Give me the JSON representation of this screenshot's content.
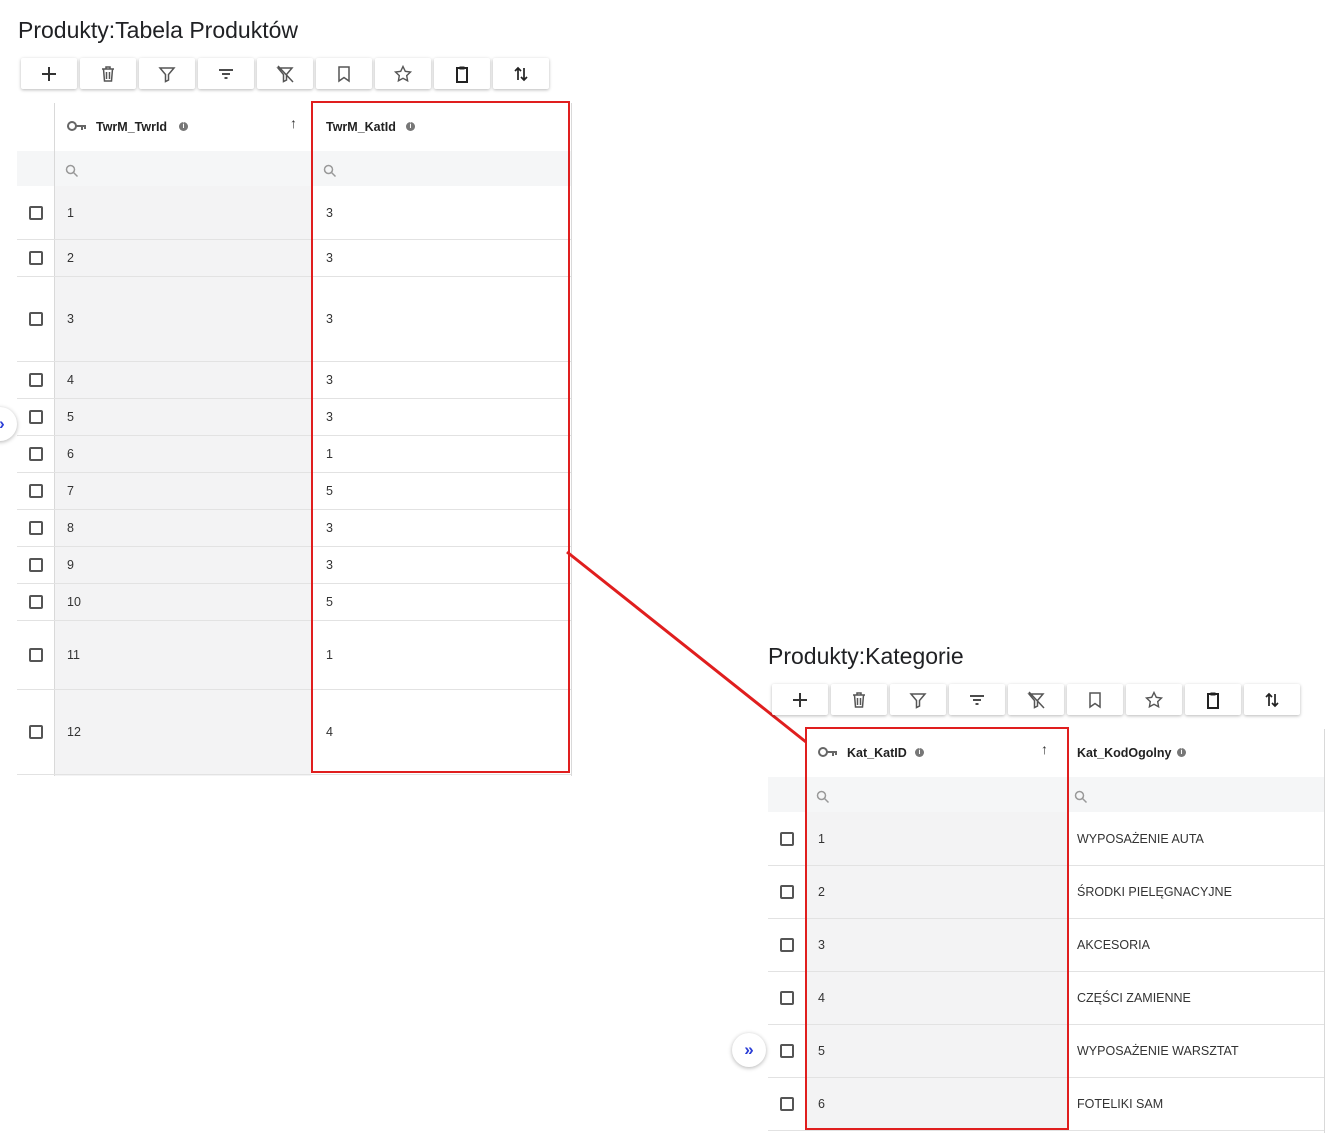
{
  "panel1": {
    "title": "Produkty:Tabela Produktów",
    "col1_header": "TwrM_TwrId",
    "col2_header": "TwrM_KatId",
    "sort_arrow": "↑",
    "rows": [
      {
        "id": "1",
        "kat": "3"
      },
      {
        "id": "2",
        "kat": "3"
      },
      {
        "id": "3",
        "kat": "3"
      },
      {
        "id": "4",
        "kat": "3"
      },
      {
        "id": "5",
        "kat": "3"
      },
      {
        "id": "6",
        "kat": "1"
      },
      {
        "id": "7",
        "kat": "5"
      },
      {
        "id": "8",
        "kat": "3"
      },
      {
        "id": "9",
        "kat": "3"
      },
      {
        "id": "10",
        "kat": "5"
      },
      {
        "id": "11",
        "kat": "1"
      },
      {
        "id": "12",
        "kat": "4"
      }
    ]
  },
  "panel2": {
    "title": "Produkty:Kategorie",
    "col1_header": "Kat_KatID",
    "col2_header": "Kat_KodOgolny",
    "sort_arrow": "↑",
    "rows": [
      {
        "id": "1",
        "kod": "WYPOSAŻENIE AUTA"
      },
      {
        "id": "2",
        "kod": "ŚRODKI PIELĘGNACYJNE"
      },
      {
        "id": "3",
        "kod": "AKCESORIA"
      },
      {
        "id": "4",
        "kod": "CZĘŚCI ZAMIENNE"
      },
      {
        "id": "5",
        "kod": "WYPOSAŻENIE WARSZTAT"
      },
      {
        "id": "6",
        "kod": "FOTELIKI SAM"
      }
    ]
  },
  "toolbar_icons": [
    "plus-icon",
    "trash-icon",
    "filter-icon",
    "sort-lines-icon",
    "clear-filter-icon",
    "bookmark-icon",
    "star-icon",
    "clipboard-icon",
    "swap-vertical-icon"
  ],
  "expander_glyph": "»",
  "info_glyph": "i",
  "colors": {
    "highlight": "#e01e1e",
    "expander": "#2b3ed6"
  }
}
